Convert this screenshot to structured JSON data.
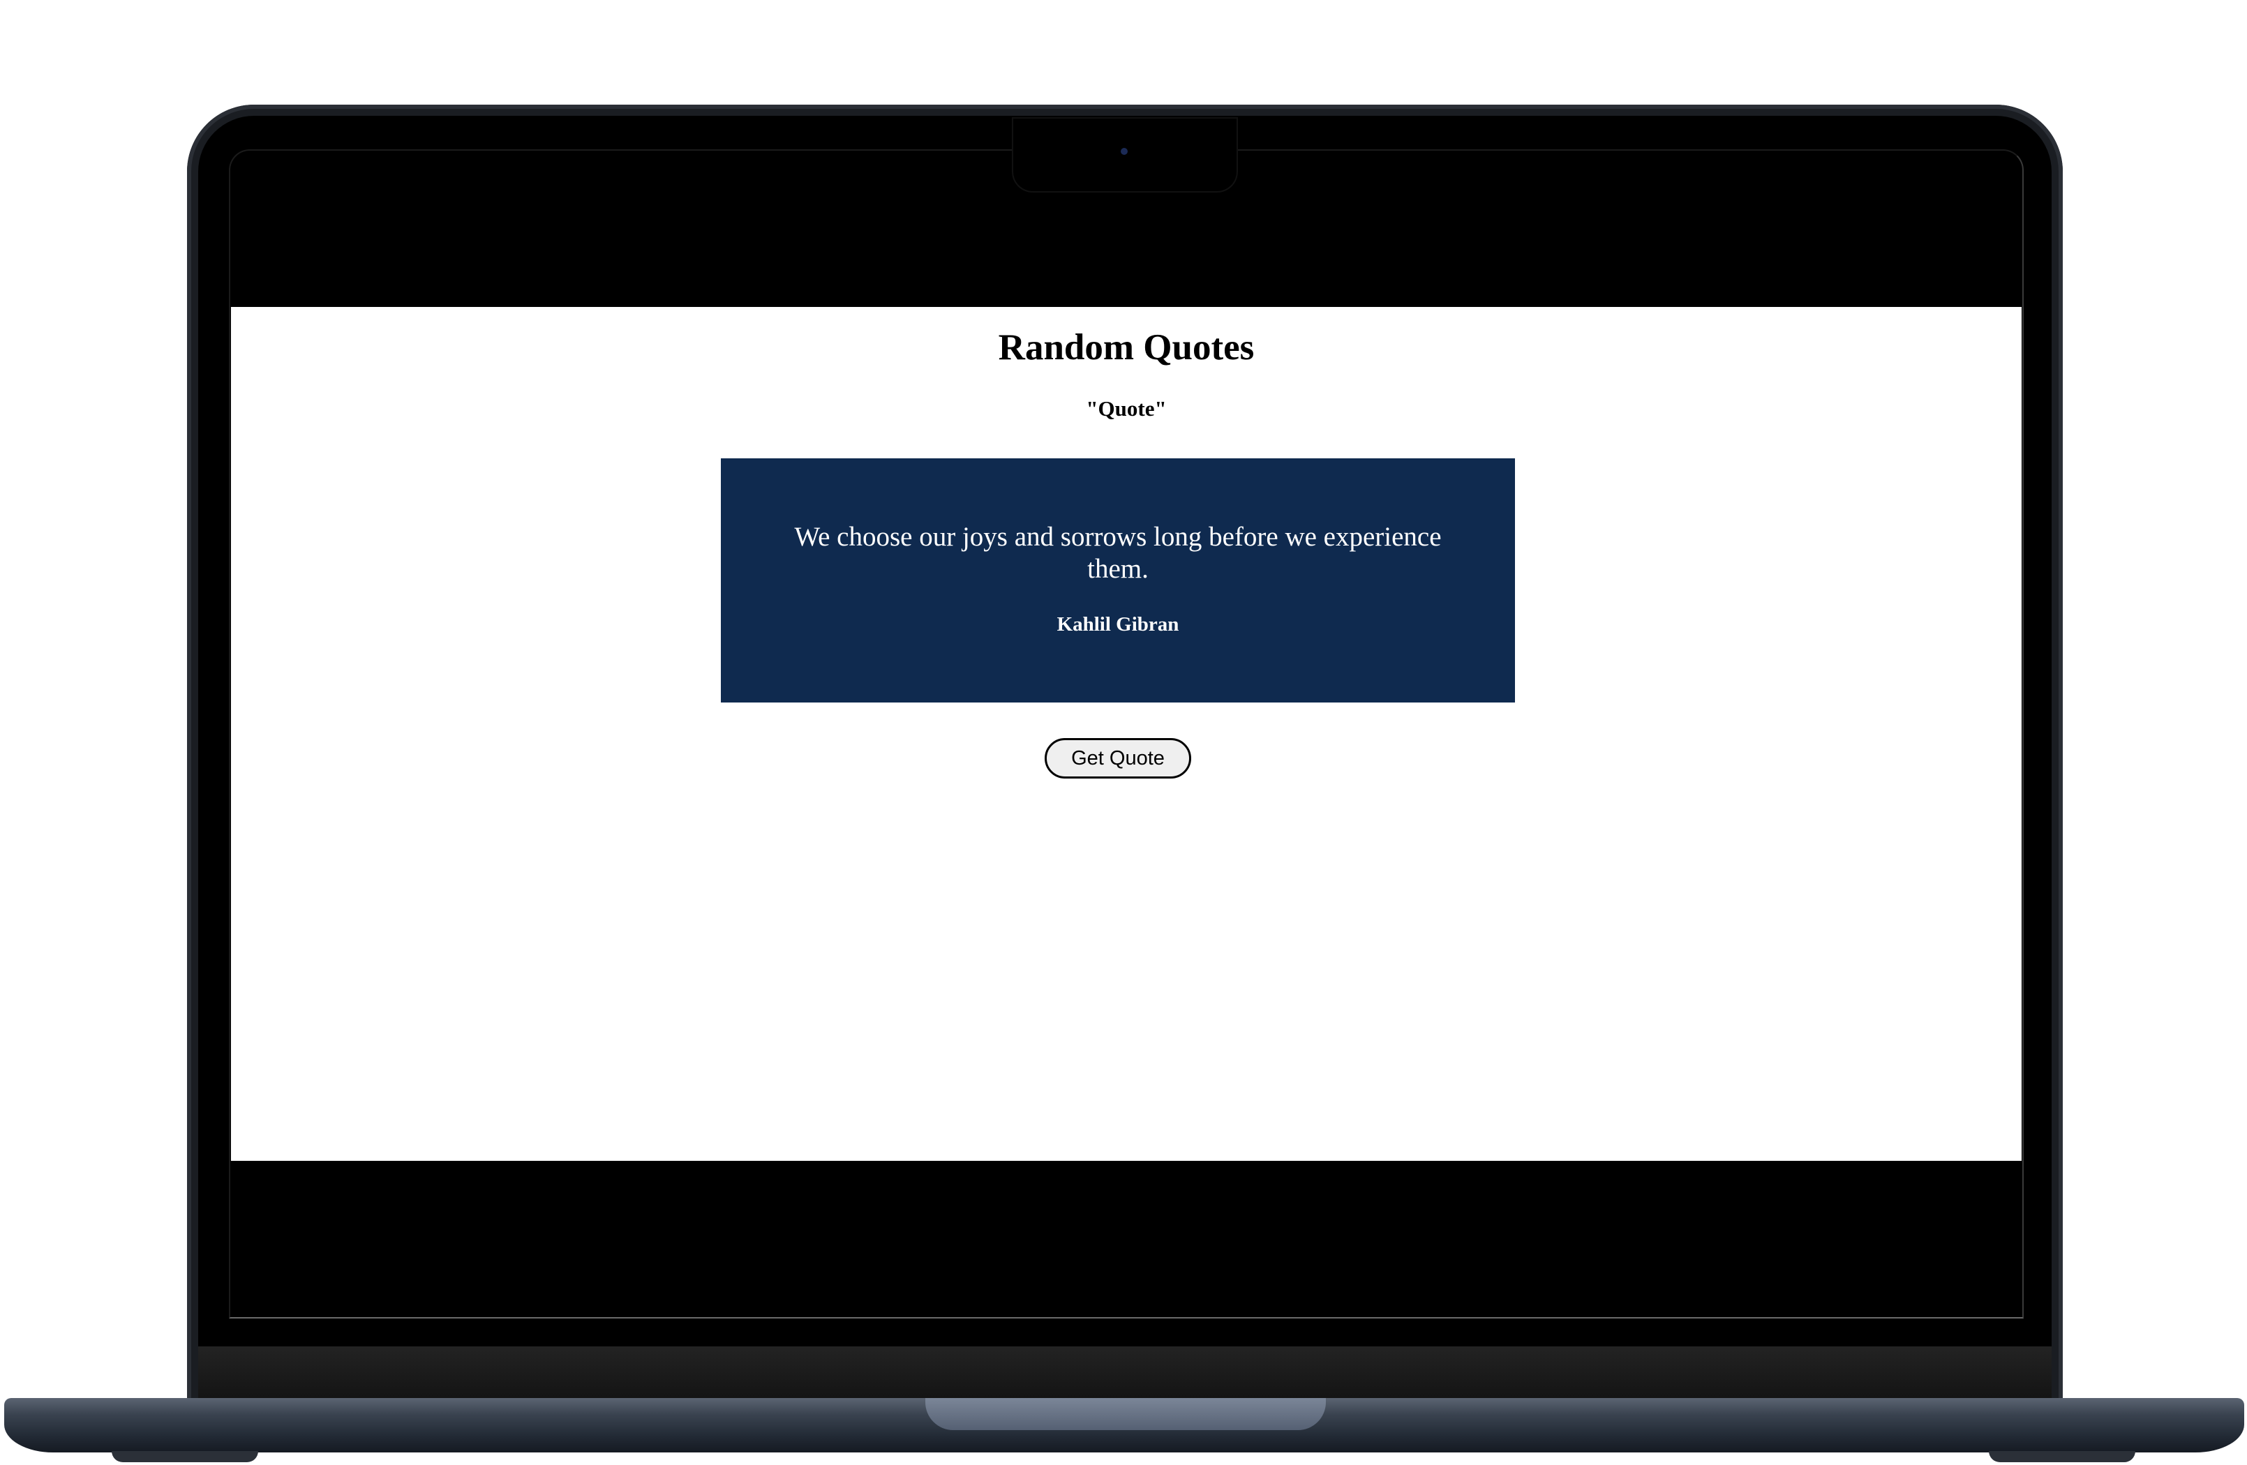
{
  "page": {
    "title": "Random Quotes",
    "subtitle": "\"Quote\""
  },
  "quote": {
    "text": "We choose our joys and sorrows long before we experience them.",
    "author": "Kahlil Gibran"
  },
  "actions": {
    "get_quote_label": "Get Quote"
  },
  "colors": {
    "quote_card_background": "#0f2a4f",
    "quote_text": "#ffffff",
    "page_background": "#ffffff",
    "laptop_bezel": "#000000",
    "laptop_body": "#1a1d22"
  }
}
